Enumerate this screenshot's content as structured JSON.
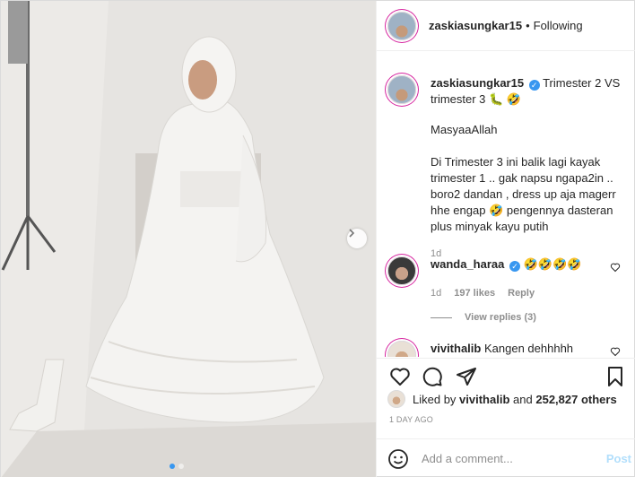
{
  "header": {
    "username": "zaskiasungkar15",
    "separator": "•",
    "follow_status": "Following"
  },
  "caption": {
    "username": "zaskiasungkar15",
    "line1": "Trimester 2 VS trimester 3",
    "emojis": "🐛 🤣",
    "line2": "MasyaaAllah",
    "line3": "Di Trimester 3 ini balik lagi kayak trimester 1 .. gak napsu ngapa2in .. boro2 dandan , dress up aja magerr hhe engap",
    "line3_emoji": "🤣",
    "line3_tail": "pengennya dasteran plus minyak kayu putih",
    "age": "1d"
  },
  "comments": [
    {
      "username": "wanda_haraa",
      "text": "🤣🤣🤣🤣",
      "age": "1d",
      "likes": "197 likes",
      "reply_label": "Reply",
      "view_replies": "View replies (3)"
    },
    {
      "username": "vivithalib",
      "text": "Kangen dehhhhh"
    }
  ],
  "likes": {
    "prefix": "Liked by",
    "first_user": "vivithalib",
    "connector": "and",
    "others": "252,827 others"
  },
  "date": "1 DAY AGO",
  "add_comment": {
    "placeholder": "Add a comment...",
    "post_label": "Post"
  },
  "icons": {
    "smile": "smile-icon",
    "heart": "heart-icon",
    "comment": "comment-icon",
    "share": "paper-plane-icon",
    "save": "bookmark-icon",
    "next": "chevron-right-icon"
  },
  "colors": {
    "verified": "#3897f0",
    "post_button": "#b2dffc",
    "muted": "#8e8e8e"
  }
}
